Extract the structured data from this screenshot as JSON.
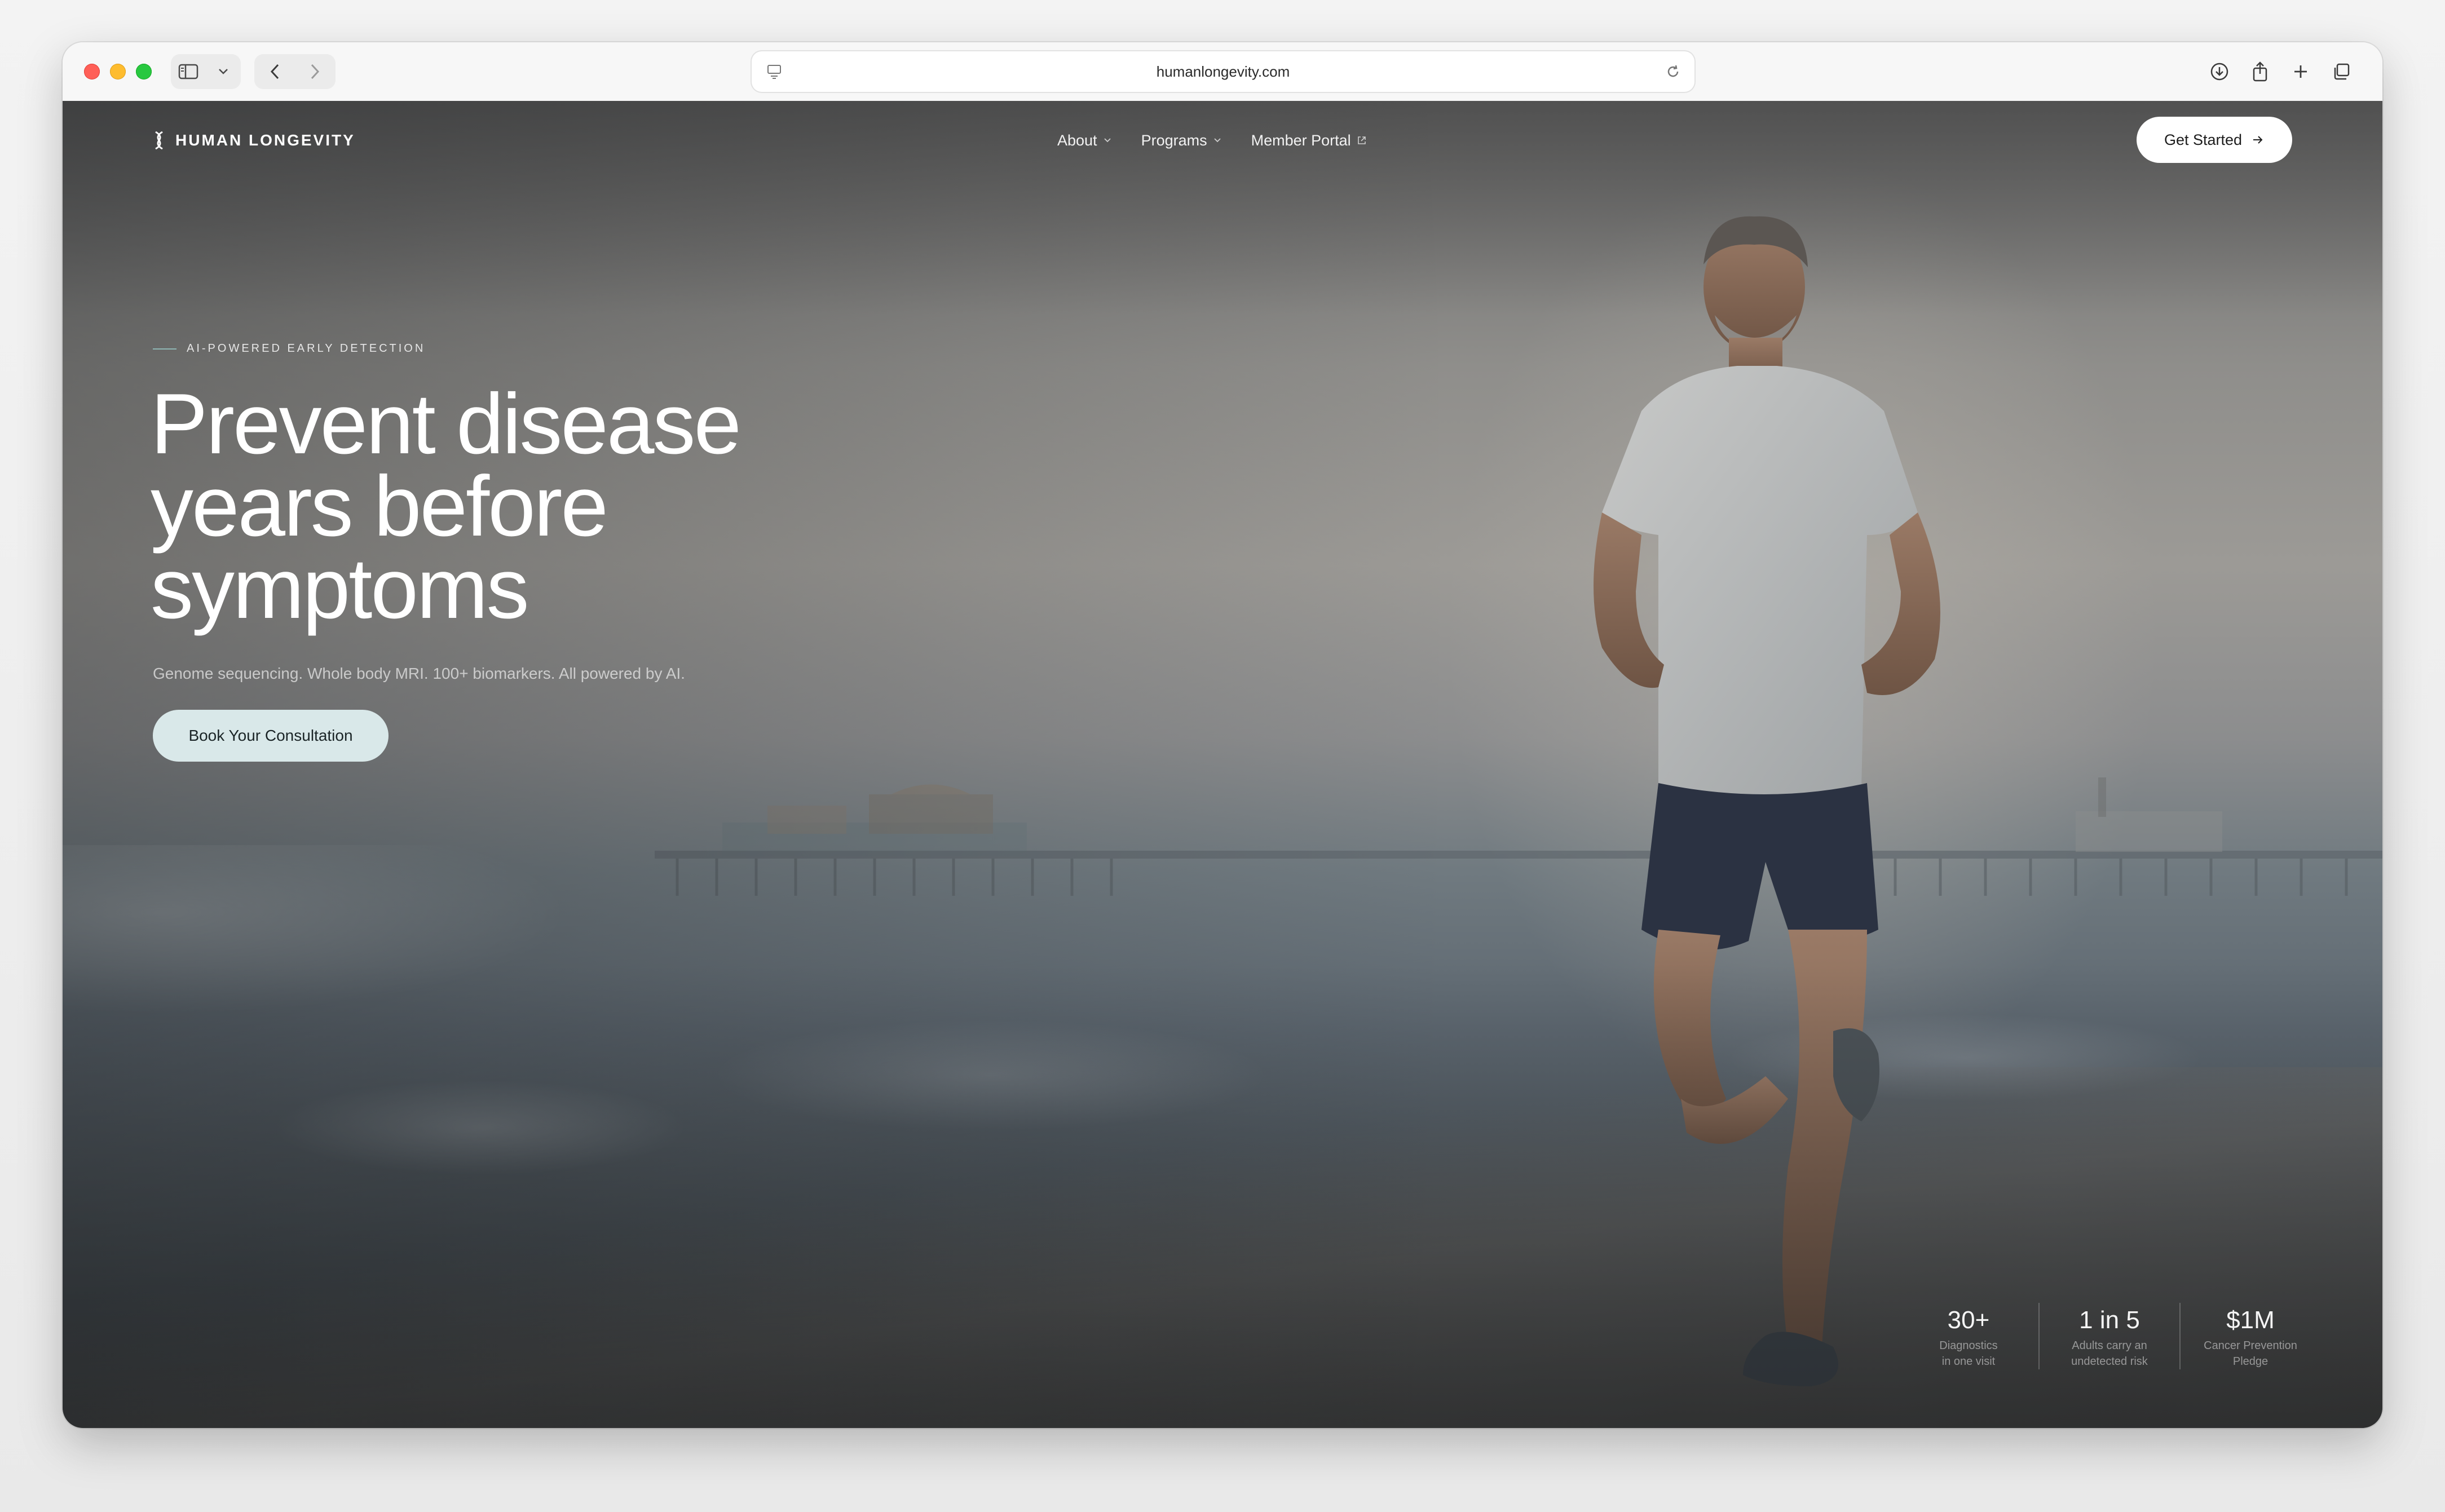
{
  "browser": {
    "url": "humanlongevity.com"
  },
  "nav": {
    "brand": "HUMAN LONGEVITY",
    "links": [
      {
        "label": "About",
        "has_dropdown": true
      },
      {
        "label": "Programs",
        "has_dropdown": true
      },
      {
        "label": "Member Portal",
        "external": true
      }
    ],
    "cta_label": "Get Started"
  },
  "hero": {
    "eyebrow": "AI-POWERED EARLY DETECTION",
    "headline_line1": "Prevent disease",
    "headline_line2": "years before",
    "headline_line3": "symptoms",
    "subhead": "Genome sequencing. Whole body MRI. 100+ biomarkers. All powered by AI.",
    "cta_label": "Book Your Consultation"
  },
  "stats": [
    {
      "value": "30+",
      "label_line1": "Diagnostics",
      "label_line2": "in one visit"
    },
    {
      "value": "1 in 5",
      "label_line1": "Adults carry an",
      "label_line2": "undetected risk"
    },
    {
      "value": "$1M",
      "label_line1": "Cancer Prevention",
      "label_line2": "Pledge"
    }
  ],
  "colors": {
    "accent": "#d9e8e9",
    "eyebrow_line": "#8fb7b4"
  }
}
